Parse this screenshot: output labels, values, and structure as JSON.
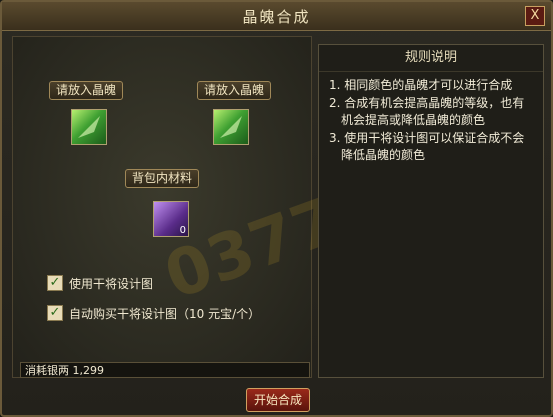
{
  "window": {
    "title": "晶魄合成",
    "close_label": "X"
  },
  "slots": {
    "slot1_label": "请放入晶魄",
    "slot2_label": "请放入晶魄",
    "material_label": "背包内材料",
    "material_count": "0"
  },
  "options": {
    "use_design": {
      "label": "使用干将设计图",
      "checked": true
    },
    "auto_buy": {
      "label": "自动购买干将设计图（10 元宝/个）",
      "checked": true
    }
  },
  "cost": {
    "text": "消耗银两 1,299"
  },
  "start_button": "开始合成",
  "rules": {
    "title": "规则说明",
    "items": [
      "1. 相同颜色的晶魄才可以进行合成",
      "2. 合成有机会提高晶魄的等级，也有机会提高或降低晶魄的颜色",
      "3. 使用干将设计图可以保证合成不会降低晶魄的颜色"
    ]
  },
  "watermark": "0377"
}
